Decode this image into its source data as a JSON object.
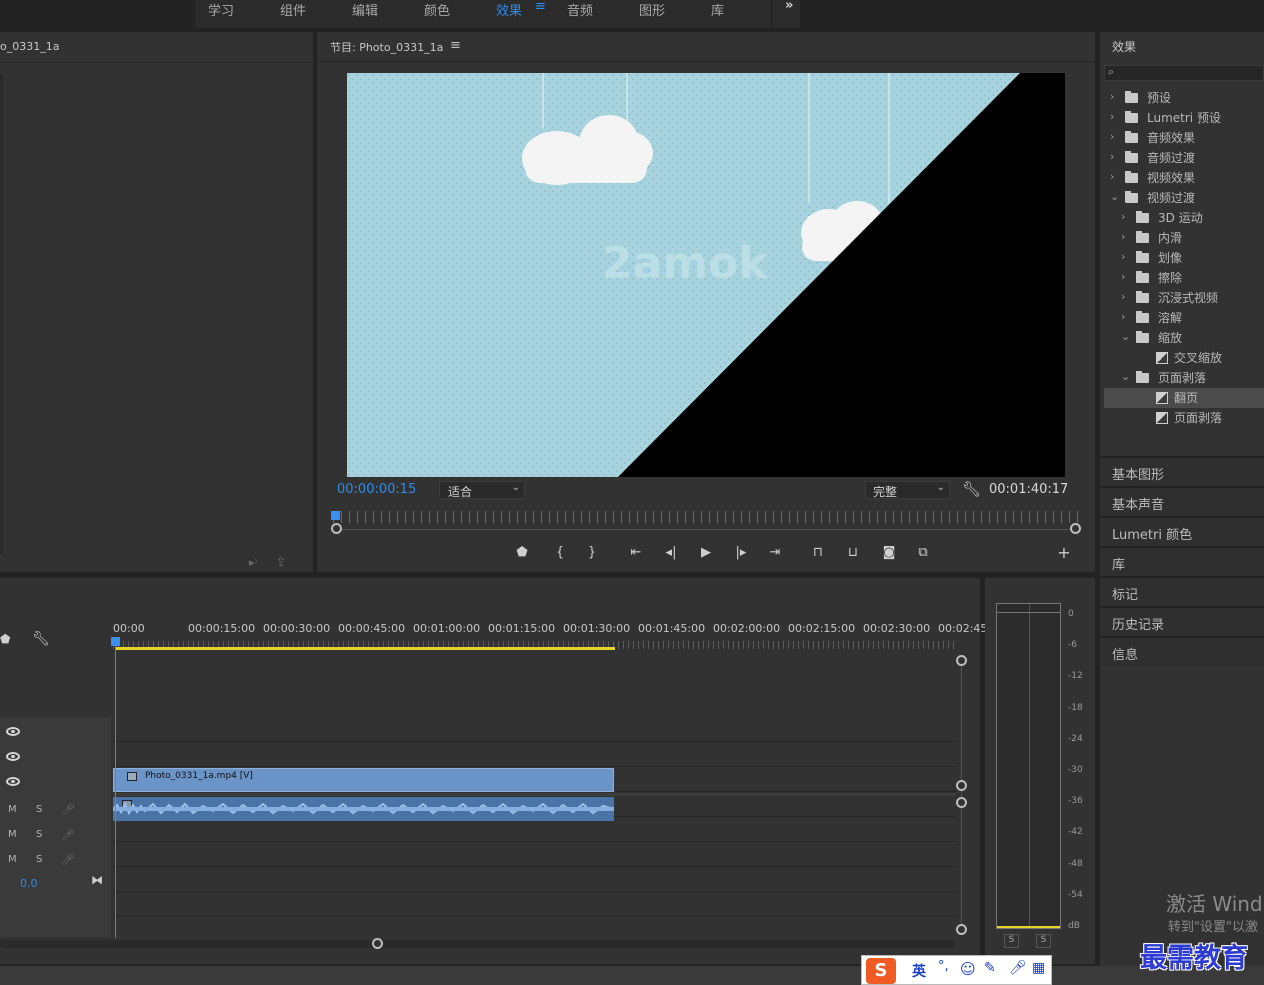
{
  "workspaces": {
    "tabs": [
      "学习",
      "组件",
      "编辑",
      "颜色",
      "效果",
      "音频",
      "图形",
      "库"
    ],
    "active": "效果",
    "menu_icon": "hamburger-icon",
    "more_icon": "double-chevron-right-icon"
  },
  "source_panel": {
    "title": "o_0331_1a"
  },
  "program_monitor": {
    "title": "节目: Photo_0331_1a",
    "menu_icon": "hamburger-icon",
    "watermark": "2amok",
    "timecode": "00:00:00:15",
    "fit_select": "适合",
    "quality_select": "完整",
    "duration": "00:01:40:17"
  },
  "effects_panel": {
    "title": "效果",
    "search_placeholder": "",
    "tree": [
      {
        "label": "预设",
        "depth": 0,
        "type": "preset-folder",
        "expanded": false
      },
      {
        "label": "Lumetri 预设",
        "depth": 0,
        "type": "preset-folder",
        "expanded": false
      },
      {
        "label": "音频效果",
        "depth": 0,
        "type": "folder",
        "expanded": false
      },
      {
        "label": "音频过渡",
        "depth": 0,
        "type": "folder",
        "expanded": false
      },
      {
        "label": "视频效果",
        "depth": 0,
        "type": "folder",
        "expanded": false
      },
      {
        "label": "视频过渡",
        "depth": 0,
        "type": "folder",
        "expanded": true
      },
      {
        "label": "3D 运动",
        "depth": 1,
        "type": "folder",
        "expanded": false
      },
      {
        "label": "内滑",
        "depth": 1,
        "type": "folder",
        "expanded": false
      },
      {
        "label": "划像",
        "depth": 1,
        "type": "folder",
        "expanded": false
      },
      {
        "label": "擦除",
        "depth": 1,
        "type": "folder",
        "expanded": false
      },
      {
        "label": "沉浸式视频",
        "depth": 1,
        "type": "folder",
        "expanded": false
      },
      {
        "label": "溶解",
        "depth": 1,
        "type": "folder",
        "expanded": false
      },
      {
        "label": "缩放",
        "depth": 1,
        "type": "folder",
        "expanded": true
      },
      {
        "label": "交叉缩放",
        "depth": 2,
        "type": "transition",
        "expanded": false
      },
      {
        "label": "页面剥落",
        "depth": 1,
        "type": "folder",
        "expanded": true
      },
      {
        "label": "翻页",
        "depth": 2,
        "type": "transition",
        "expanded": false,
        "selected": true
      },
      {
        "label": "页面剥落",
        "depth": 2,
        "type": "transition",
        "expanded": false
      }
    ]
  },
  "side_panels": [
    "基本图形",
    "基本声音",
    "Lumetri 颜色",
    "库",
    "标记",
    "历史记录",
    "信息"
  ],
  "timeline": {
    "ruler": [
      "00:00",
      "00:00:15:00",
      "00:00:30:00",
      "00:00:45:00",
      "00:01:00:00",
      "00:01:15:00",
      "00:01:30:00",
      "00:01:45:00",
      "00:02:00:00",
      "00:02:15:00",
      "00:02:30:00",
      "00:02:45:"
    ],
    "video_clip": "Photo_0331_1a.mp4 [V]",
    "track_letters": [
      "M",
      "S"
    ],
    "mix_value": "0.0"
  },
  "audio_meter": {
    "scale": [
      "0",
      "-6",
      "-12",
      "-18",
      "-24",
      "-30",
      "-36",
      "-42",
      "-48",
      "-54",
      "dB"
    ],
    "solo_buttons": [
      "S",
      "S"
    ]
  },
  "os_overlay": {
    "activate_title": "激活 Wind",
    "activate_sub": "转到\"设置\"以激",
    "ime_label": "英",
    "ime_punct": "°,",
    "brand": "最需教育"
  },
  "colors": {
    "accent": "#2d8ceb",
    "clip_video": "#6b95c8",
    "clip_audio": "#4a73a6",
    "inout_bar": "#e7d228",
    "playhead": "#3d8ef0",
    "brand": "#2d3bd0"
  }
}
